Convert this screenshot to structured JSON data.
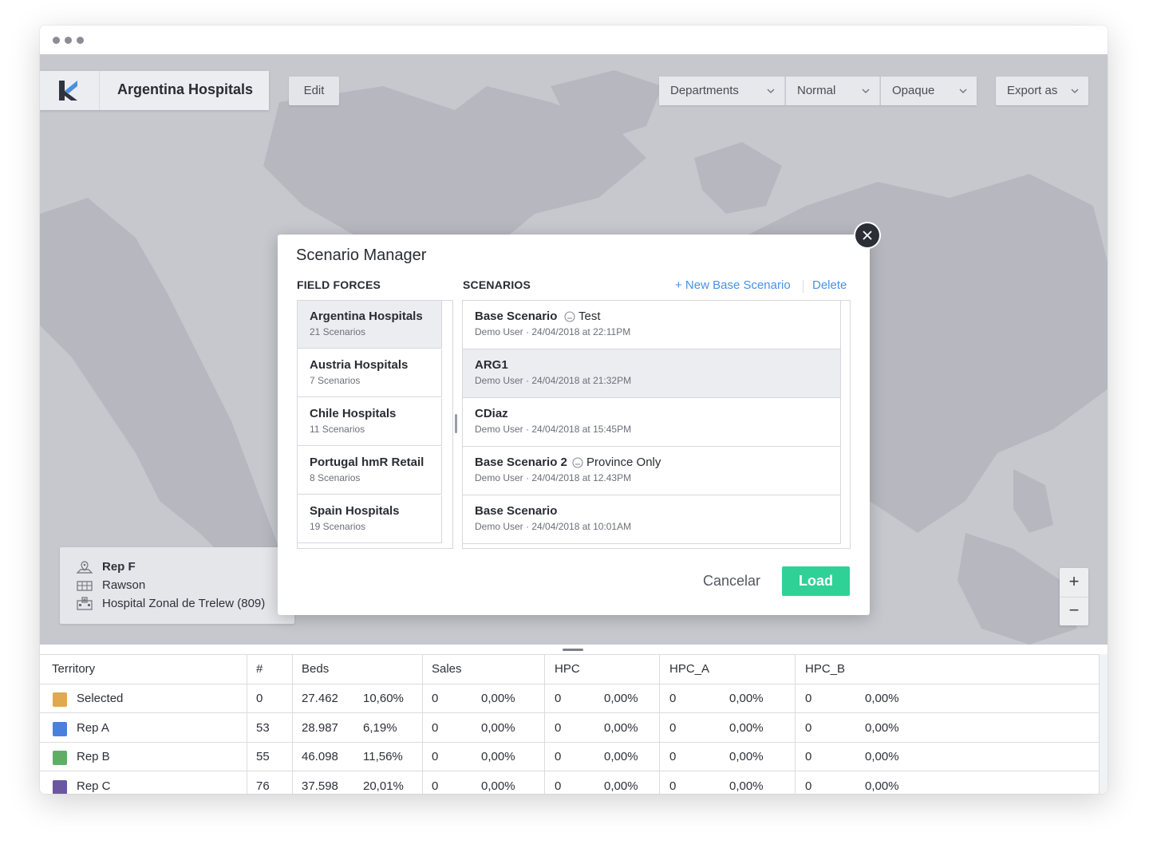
{
  "app": {
    "title": "Argentina Hospitals",
    "edit_label": "Edit"
  },
  "toolbar": {
    "departments": "Departments",
    "normal": "Normal",
    "opaque": "Opaque",
    "export": "Export as"
  },
  "info_card": {
    "rep": "Rep F",
    "city": "Rawson",
    "hospital": "Hospital Zonal de Trelew (809)"
  },
  "zoom": {
    "plus": "+",
    "minus": "−"
  },
  "modal": {
    "title": "Scenario Manager",
    "field_forces_header": "FIELD FORCES",
    "scenarios_header": "SCENARIOS",
    "new_base_label": "+ New Base Scenario",
    "delete_label": "Delete",
    "cancel_label": "Cancelar",
    "load_label": "Load",
    "field_forces": [
      {
        "name": "Argentina Hospitals",
        "count": "21 Scenarios"
      },
      {
        "name": "Austria Hospitals",
        "count": "7 Scenarios"
      },
      {
        "name": "Chile Hospitals",
        "count": "11 Scenarios"
      },
      {
        "name": "Portugal hmR Retail",
        "count": "8 Scenarios"
      },
      {
        "name": "Spain Hospitals",
        "count": "19 Scenarios"
      }
    ],
    "scenarios": [
      {
        "name": "Base Scenario",
        "tag": "Test",
        "meta": "Demo User · 24/04/2018 at 22:11PM"
      },
      {
        "name": "ARG1",
        "tag": "",
        "meta": "Demo User · 24/04/2018 at 21:32PM"
      },
      {
        "name": "CDiaz",
        "tag": "",
        "meta": "Demo User · 24/04/2018 at 15:45PM"
      },
      {
        "name": "Base Scenario 2",
        "tag": "Province Only",
        "meta": "Demo User · 24/04/2018 at 12.43PM"
      },
      {
        "name": "Base Scenario",
        "tag": "",
        "meta": "Demo User · 24/04/2018 at 10:01AM"
      }
    ]
  },
  "table": {
    "headers": [
      "Territory",
      "#",
      "Beds",
      "Sales",
      "HPC",
      "HPC_A",
      "HPC_B"
    ],
    "rows": [
      {
        "name": "Selected",
        "color": "#e0a94e",
        "count": "0",
        "beds": "27.462",
        "beds_pct": "10,60%",
        "sales": "0",
        "sales_pct": "0,00%",
        "hpc": "0",
        "hpc_pct": "0,00%",
        "hpca": "0",
        "hpca_pct": "0,00%",
        "hpcb": "0",
        "hpcb_pct": "0,00%"
      },
      {
        "name": "Rep A",
        "color": "#4a7fdc",
        "count": "53",
        "beds": "28.987",
        "beds_pct": "6,19%",
        "sales": "0",
        "sales_pct": "0,00%",
        "hpc": "0",
        "hpc_pct": "0,00%",
        "hpca": "0",
        "hpca_pct": "0,00%",
        "hpcb": "0",
        "hpcb_pct": "0,00%"
      },
      {
        "name": "Rep B",
        "color": "#62ad64",
        "count": "55",
        "beds": "46.098",
        "beds_pct": "11,56%",
        "sales": "0",
        "sales_pct": "0,00%",
        "hpc": "0",
        "hpc_pct": "0,00%",
        "hpca": "0",
        "hpca_pct": "0,00%",
        "hpcb": "0",
        "hpcb_pct": "0,00%"
      },
      {
        "name": "Rep C",
        "color": "#6b57a0",
        "count": "76",
        "beds": "37.598",
        "beds_pct": "20,01%",
        "sales": "0",
        "sales_pct": "0,00%",
        "hpc": "0",
        "hpc_pct": "0,00%",
        "hpca": "0",
        "hpca_pct": "0,00%",
        "hpcb": "0",
        "hpcb_pct": "0,00%"
      }
    ]
  }
}
